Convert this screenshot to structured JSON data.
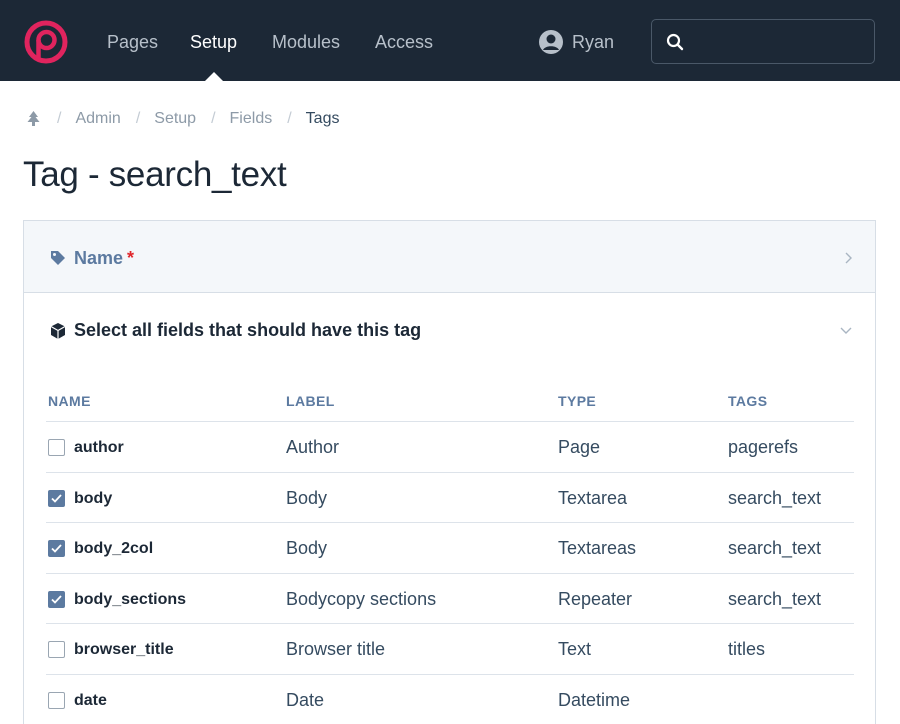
{
  "nav": {
    "items": [
      {
        "label": "Pages"
      },
      {
        "label": "Setup"
      },
      {
        "label": "Modules"
      },
      {
        "label": "Access"
      }
    ],
    "active": "Setup",
    "user_name": "Ryan",
    "search_placeholder": "",
    "brand_color": "#e0245e"
  },
  "breadcrumb": {
    "items": [
      "Admin",
      "Setup",
      "Fields"
    ],
    "current": "Tags"
  },
  "page": {
    "title": "Tag - search_text"
  },
  "sections": {
    "name": {
      "title": "Name",
      "required_mark": "*"
    },
    "fields": {
      "title": "Select all fields that should have this tag"
    }
  },
  "table": {
    "headers": {
      "name": "NAME",
      "label": "LABEL",
      "type": "TYPE",
      "tags": "TAGS"
    },
    "rows": [
      {
        "name": "author",
        "label": "Author",
        "type": "Page",
        "tags": "pagerefs",
        "checked": false
      },
      {
        "name": "body",
        "label": "Body",
        "type": "Textarea",
        "tags": "search_text",
        "checked": true
      },
      {
        "name": "body_2col",
        "label": "Body",
        "type": "Textareas",
        "tags": "search_text",
        "checked": true
      },
      {
        "name": "body_sections",
        "label": "Bodycopy sections",
        "type": "Repeater",
        "tags": "search_text",
        "checked": true
      },
      {
        "name": "browser_title",
        "label": "Browser title",
        "type": "Text",
        "tags": "titles",
        "checked": false
      },
      {
        "name": "date",
        "label": "Date",
        "type": "Datetime",
        "tags": "",
        "checked": false
      }
    ]
  },
  "colors": {
    "topbar": "#1c2836",
    "accent": "#5c7aa0",
    "required": "#e0262b"
  }
}
